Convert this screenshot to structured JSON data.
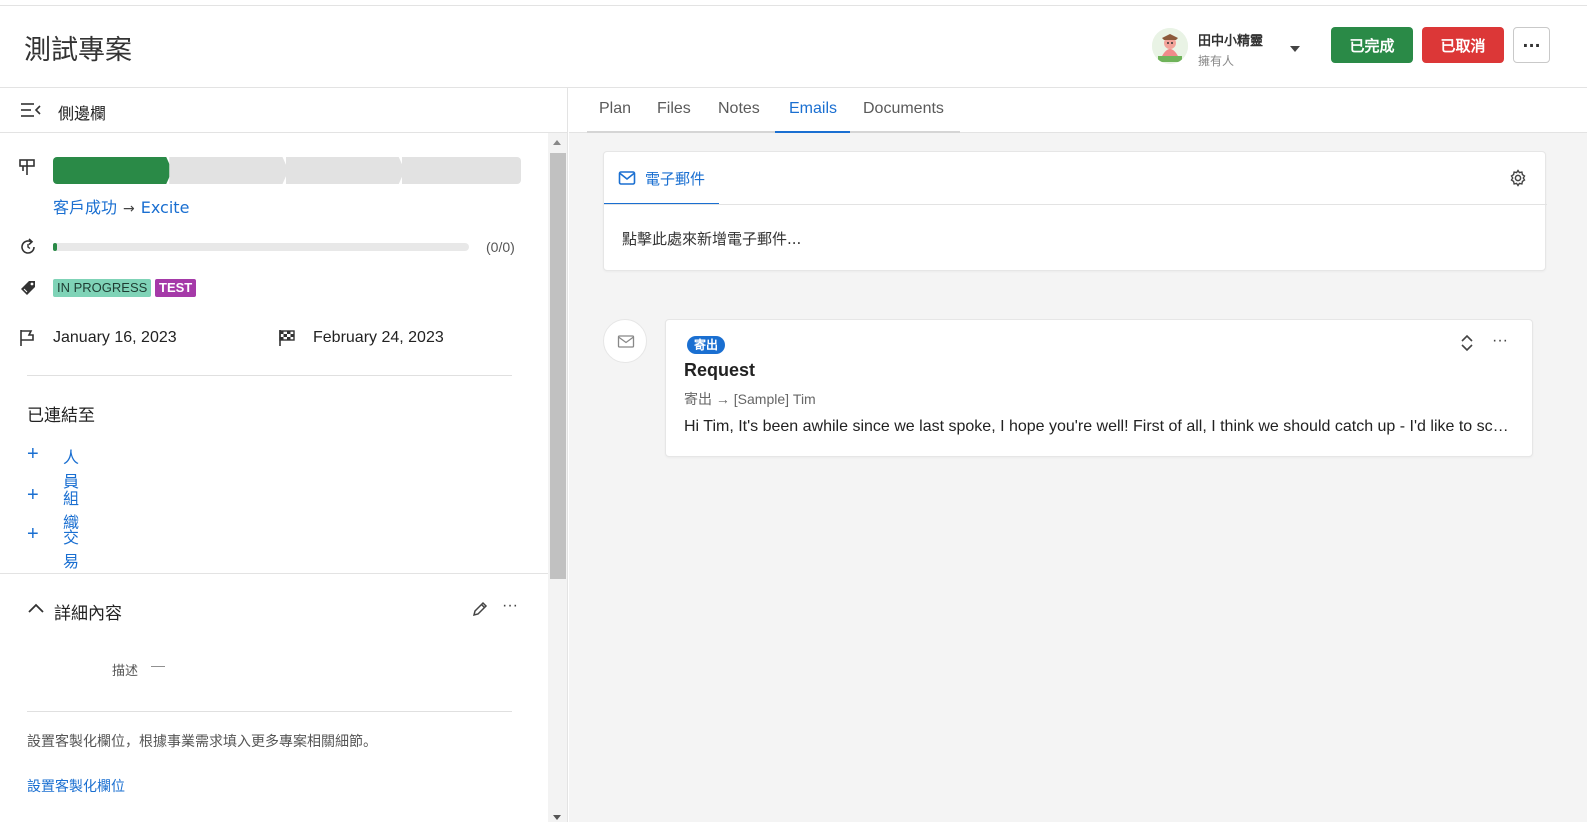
{
  "header": {
    "project_title": "測試專案",
    "owner": {
      "name": "田中小精靈",
      "role": "擁有人"
    },
    "buttons": {
      "done": "已完成",
      "cancel": "已取消",
      "more": "···"
    }
  },
  "sidebar": {
    "title": "側邊欄",
    "pipeline": {
      "stages_total": 4,
      "active_stage": 1,
      "breadcrumb_from": "客戶成功",
      "breadcrumb_to": "Excite"
    },
    "progress": {
      "fraction": 0.01,
      "count": "(0/0)"
    },
    "tags": [
      "IN PROGRESS",
      "TEST"
    ],
    "dates": {
      "start": "January 16, 2023",
      "end": "February 24, 2023"
    },
    "connected": {
      "label": "已連結至",
      "links": [
        "人員",
        "組織",
        "交易"
      ]
    },
    "details": {
      "title": "詳細內容",
      "more": "···",
      "description_label": "描述",
      "description_value": "—",
      "custom_hint": "設置客製化欄位，根據事業需求填入更多專案相關細節。",
      "custom_link": "設置客製化欄位"
    }
  },
  "tabs": [
    {
      "label": "Plan",
      "active": false
    },
    {
      "label": "Files",
      "active": false
    },
    {
      "label": "Notes",
      "active": false
    },
    {
      "label": "Emails",
      "active": true
    },
    {
      "label": "Documents",
      "active": false
    }
  ],
  "compose": {
    "tab_label": "電子郵件",
    "placeholder": "點擊此處來新增電子郵件..."
  },
  "email": {
    "badge": "寄出",
    "subject": "Request",
    "route": "寄出 → [Sample] Tim",
    "body": "Hi Tim, It's been awhile since we last spoke, I hope you're well! First of all, I think we should catch up - I'd like to schedule a call with you next week.",
    "more": "···"
  },
  "colors": {
    "accent": "#1a6fd1",
    "success": "#2a8a47",
    "danger": "#dc3737",
    "tag_progress": "#7fd3b7",
    "tag_test": "#a53aa8"
  }
}
